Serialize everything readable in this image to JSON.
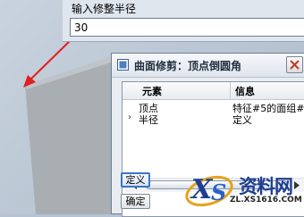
{
  "prompt": {
    "label": "输入修整半径",
    "value": "30"
  },
  "dialog": {
    "title": "曲面修剪：顶点倒圆角",
    "columns": [
      "元素",
      "信息"
    ],
    "rows": [
      {
        "element": "顶点",
        "info": "特征#5的面组#",
        "expander": ""
      },
      {
        "element": "半径",
        "info": "定义",
        "expander": "›"
      }
    ],
    "buttons": {
      "define": "定义",
      "ok": "确定"
    }
  },
  "watermark": {
    "name": "资料网",
    "url": "ZL.XS1616.COM"
  },
  "icons": [
    "dialog-app-icon",
    "close-icon",
    "scroll-left-icon",
    "scroll-right-icon",
    "expand-arrow-icon",
    "watermark-logo-icon"
  ],
  "colors": {
    "viewport": "#b9c6d3",
    "arrow": "#e02020",
    "accent": "#3b76c4",
    "watermark": "#1e3f8f"
  }
}
